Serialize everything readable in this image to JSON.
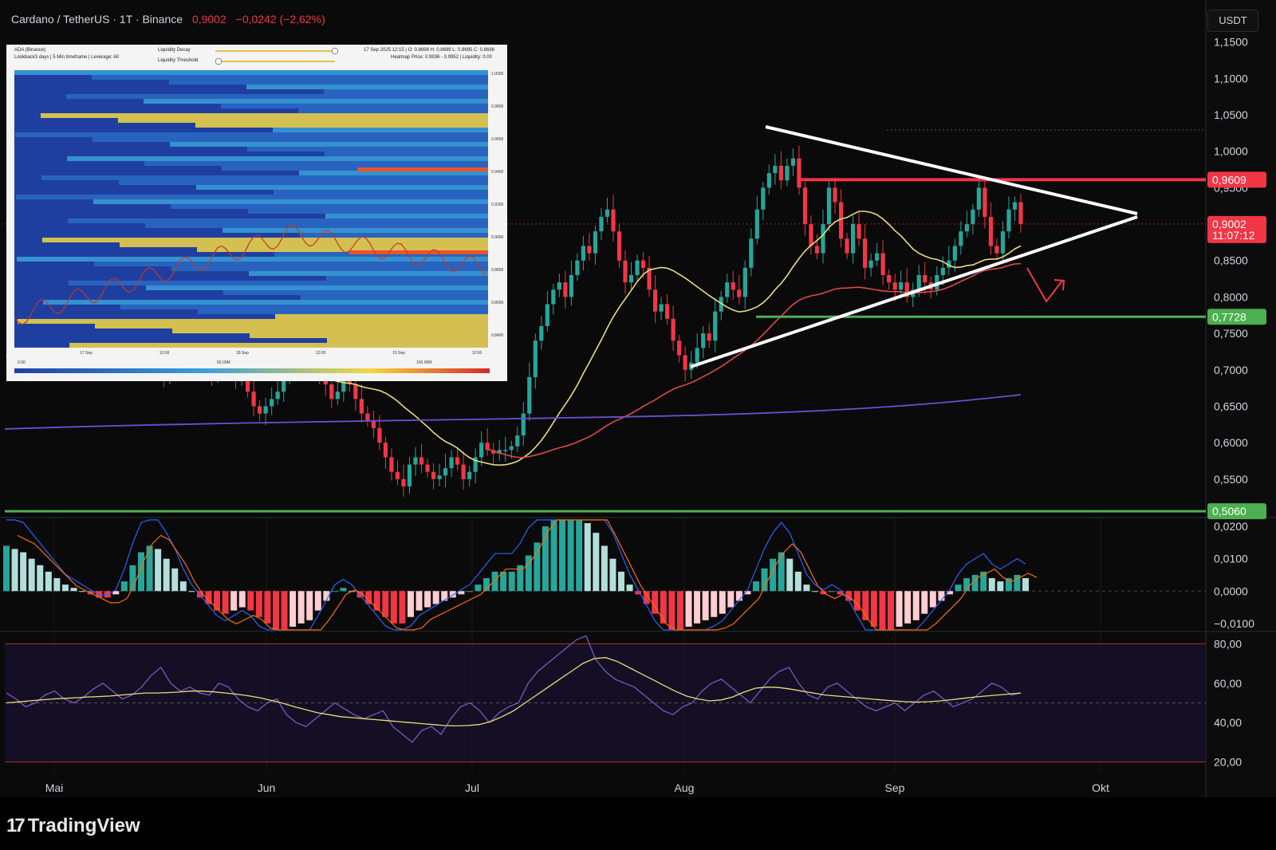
{
  "header": {
    "symbol": "Cardano / TetherUS · 1T · Binance",
    "price": "0,9002",
    "change": "−0,0242 (−2,62%)"
  },
  "currency_button": "USDT",
  "brand": "TradingView",
  "inset": {
    "title_line1": "ADA (Binance)",
    "title_line2": "Lookback3 days | 5 Min timeframe | Leverage: All",
    "setting1": "Liquidity Decay",
    "setting2": "Liquidity Threshold",
    "ohlc": "17 Sep 2025 12:15 | O: 0.8698 H: 0.8699 L: 0.8695 C: 0.8696",
    "heatmap_info": "Heatmap Price: 0.9936 - 0.9952 | Liquidity: 0.00",
    "x_ticks": [
      "17 Sep",
      "12:00",
      "18 Sep",
      "12:00",
      "19 Sep",
      "12:00"
    ],
    "y_ticks": [
      "1.0000",
      "0.9800",
      "0.9600",
      "0.9400",
      "0.9200",
      "0.9000",
      "0.8800",
      "0.8600",
      "0.8400"
    ],
    "legend_ticks": [
      "0.00",
      "50.00M",
      "100.00M"
    ],
    "colors": {
      "low": "#1f3fa0",
      "mid": "#3aa0d8",
      "high": "#f5d742",
      "max": "#e8542c"
    }
  },
  "chart_data": [
    {
      "type": "candlestick",
      "title": "Cardano / TetherUS",
      "x_ticks": [
        "Mai",
        "Jun",
        "Jul",
        "Aug",
        "Sep",
        "Okt"
      ],
      "y_ticks": [
        "1,1500",
        "1,1000",
        "1,0500",
        "1,0000",
        "0,9500",
        "0,9000",
        "0,8500",
        "0,8000",
        "0,7500",
        "0,7000",
        "0,6500",
        "0,6000",
        "0,5500"
      ],
      "ylim": [
        0.505,
        1.155
      ],
      "close_series": [
        0.72,
        0.74,
        0.7,
        0.71,
        0.73,
        0.71,
        0.72,
        0.75,
        0.74,
        0.76,
        0.78,
        0.77,
        0.75,
        0.74,
        0.75,
        0.73,
        0.72,
        0.74,
        0.76,
        0.77,
        0.75,
        0.76,
        0.74,
        0.73,
        0.72,
        0.7,
        0.69,
        0.7,
        0.72,
        0.73,
        0.74,
        0.73,
        0.71,
        0.7,
        0.69,
        0.71,
        0.72,
        0.7,
        0.69,
        0.7,
        0.67,
        0.65,
        0.64,
        0.65,
        0.66,
        0.67,
        0.69,
        0.7,
        0.71,
        0.72,
        0.7,
        0.71,
        0.69,
        0.68,
        0.66,
        0.67,
        0.69,
        0.68,
        0.66,
        0.64,
        0.63,
        0.62,
        0.6,
        0.58,
        0.56,
        0.55,
        0.54,
        0.57,
        0.58,
        0.57,
        0.56,
        0.55,
        0.555,
        0.565,
        0.58,
        0.57,
        0.55,
        0.56,
        0.58,
        0.6,
        0.59,
        0.585,
        0.59,
        0.59,
        0.595,
        0.61,
        0.64,
        0.69,
        0.74,
        0.76,
        0.79,
        0.81,
        0.82,
        0.8,
        0.83,
        0.85,
        0.87,
        0.86,
        0.89,
        0.91,
        0.92,
        0.89,
        0.85,
        0.82,
        0.83,
        0.85,
        0.84,
        0.81,
        0.78,
        0.79,
        0.77,
        0.74,
        0.72,
        0.7,
        0.71,
        0.73,
        0.75,
        0.74,
        0.78,
        0.8,
        0.82,
        0.81,
        0.8,
        0.84,
        0.88,
        0.92,
        0.95,
        0.97,
        0.98,
        0.96,
        0.98,
        0.99,
        0.95,
        0.9,
        0.87,
        0.86,
        0.9,
        0.95,
        0.93,
        0.88,
        0.86,
        0.9,
        0.88,
        0.84,
        0.85,
        0.86,
        0.83,
        0.82,
        0.81,
        0.82,
        0.8,
        0.81,
        0.83,
        0.82,
        0.81,
        0.83,
        0.84,
        0.85,
        0.87,
        0.89,
        0.9,
        0.92,
        0.95,
        0.91,
        0.87,
        0.86,
        0.89,
        0.92,
        0.93,
        0.9002
      ],
      "price_labels": [
        {
          "text": "0,9609",
          "value": 0.9609,
          "color": "#f23645"
        },
        {
          "text": "0,9002",
          "value": 0.9002,
          "color": "#f23645",
          "sub": "11:07:12"
        },
        {
          "text": "0,7728",
          "value": 0.7728,
          "color": "#4caf50"
        },
        {
          "text": "0,5060",
          "value": 0.506,
          "color": "#4caf50"
        }
      ],
      "moving_averages": [
        {
          "color": "#e8dc7a",
          "type": "short"
        },
        {
          "color": "#e04848",
          "type": "medium"
        },
        {
          "color": "#6a4fd0",
          "type": "long"
        }
      ],
      "annotations": [
        "symmetrical triangle",
        "resistance 0,9609",
        "support 0,7728",
        "support 0,5060"
      ]
    },
    {
      "type": "histogram",
      "title": "MACD",
      "y_ticks": [
        "0,0200",
        "0,0100",
        "0,0000",
        "−0,0100"
      ],
      "ylim": [
        -0.012,
        0.022
      ],
      "values": [
        0.014,
        0.013,
        0.012,
        0.01,
        0.008,
        0.006,
        0.004,
        0.002,
        0.001,
        0.0,
        -0.001,
        -0.002,
        -0.002,
        -0.001,
        0.003,
        0.008,
        0.012,
        0.014,
        0.013,
        0.01,
        0.007,
        0.003,
        0.0,
        -0.002,
        -0.004,
        -0.006,
        -0.007,
        -0.006,
        -0.005,
        -0.006,
        -0.008,
        -0.01,
        -0.012,
        -0.012,
        -0.011,
        -0.01,
        -0.009,
        -0.006,
        -0.003,
        0.0,
        0.001,
        0.0,
        -0.002,
        -0.004,
        -0.006,
        -0.008,
        -0.01,
        -0.01,
        -0.008,
        -0.006,
        -0.005,
        -0.004,
        -0.003,
        -0.002,
        -0.001,
        0.0,
        0.002,
        0.004,
        0.006,
        0.006,
        0.006,
        0.008,
        0.011,
        0.015,
        0.02,
        0.022,
        0.022,
        0.022,
        0.022,
        0.021,
        0.018,
        0.014,
        0.01,
        0.006,
        0.002,
        -0.001,
        -0.004,
        -0.007,
        -0.01,
        -0.012,
        -0.012,
        -0.011,
        -0.01,
        -0.009,
        -0.008,
        -0.007,
        -0.005,
        -0.003,
        -0.001,
        0.003,
        0.007,
        0.01,
        0.012,
        0.01,
        0.006,
        0.002,
        0.0,
        -0.001,
        0.0,
        -0.001,
        -0.003,
        -0.006,
        -0.009,
        -0.011,
        -0.012,
        -0.012,
        -0.011,
        -0.01,
        -0.009,
        -0.007,
        -0.005,
        -0.003,
        -0.001,
        0.002,
        0.004,
        0.005,
        0.006,
        0.004,
        0.003,
        0.004,
        0.005,
        0.004
      ],
      "colors": {
        "pos_strong": "#26a69a",
        "pos_weak": "#b2dfdb",
        "neg_strong": "#f23645",
        "neg_weak": "#ffcdd2"
      }
    },
    {
      "type": "line",
      "title": "RSI",
      "y_ticks": [
        "80,00",
        "60,00",
        "40,00",
        "20,00"
      ],
      "ylim": [
        15,
        85
      ],
      "bands": [
        70,
        30
      ],
      "rsi": [
        55,
        52,
        48,
        50,
        54,
        56,
        52,
        50,
        53,
        57,
        60,
        56,
        52,
        54,
        58,
        64,
        68,
        60,
        56,
        58,
        55,
        54,
        60,
        58,
        52,
        48,
        46,
        50,
        52,
        44,
        40,
        38,
        42,
        46,
        50,
        47,
        44,
        42,
        44,
        46,
        38,
        34,
        30,
        36,
        38,
        34,
        42,
        48,
        50,
        46,
        40,
        45,
        48,
        50,
        60,
        66,
        70,
        74,
        78,
        82,
        84,
        72,
        66,
        62,
        60,
        58,
        54,
        50,
        46,
        44,
        48,
        50,
        56,
        60,
        62,
        58,
        54,
        50,
        56,
        62,
        66,
        68,
        60,
        54,
        52,
        58,
        60,
        56,
        52,
        48,
        46,
        48,
        50,
        46,
        50,
        54,
        56,
        52,
        48,
        50,
        52,
        56,
        60,
        58,
        54,
        55
      ],
      "signal": [
        50,
        50.5,
        51,
        51.5,
        52,
        52.3,
        52.6,
        53,
        53.2,
        53.5,
        54,
        54.5,
        55,
        55,
        55.2,
        55.5,
        56,
        56,
        55.6,
        55,
        54.4,
        53.6,
        52.6,
        51.2,
        49.8,
        48,
        46.5,
        45,
        44,
        43,
        42.5,
        42,
        41.5,
        41,
        40.5,
        40,
        39.5,
        39,
        38.5,
        38.3,
        38.5,
        39,
        40.5,
        43,
        46,
        50,
        54,
        58,
        62,
        66,
        70,
        72.5,
        73,
        71,
        68,
        65,
        62,
        59,
        56,
        53.5,
        52,
        51,
        51.5,
        53,
        55.5,
        57.5,
        58,
        57.8,
        57,
        56,
        55,
        54,
        53.5,
        53,
        52.5,
        52,
        51.5,
        51,
        50.6,
        50.4,
        50.6,
        51,
        51.6,
        52.3,
        53,
        53.5,
        54,
        54.5,
        55
      ]
    }
  ]
}
